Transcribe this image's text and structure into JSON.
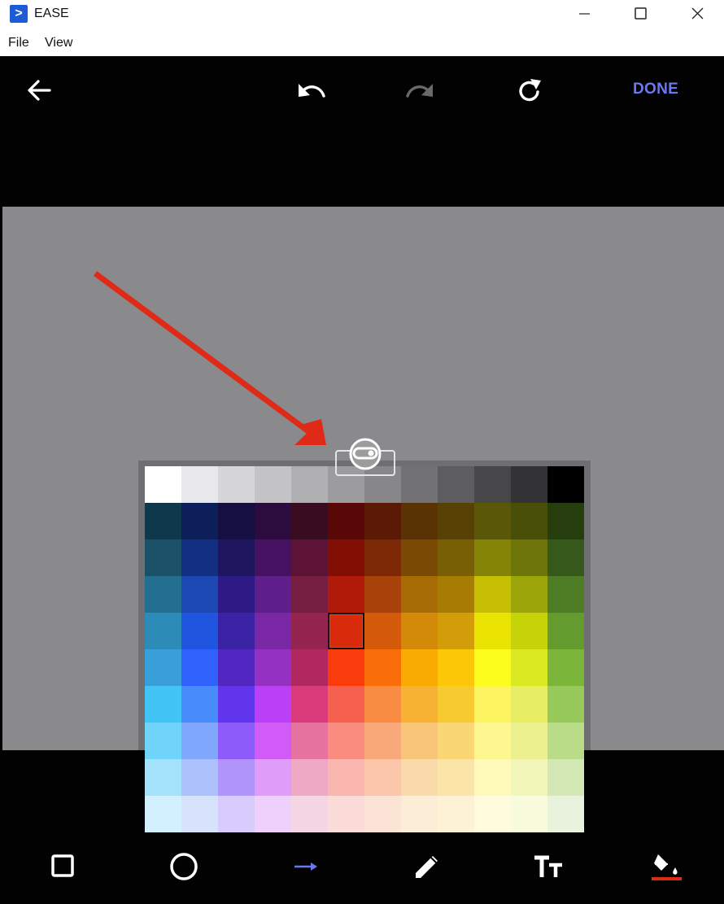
{
  "window": {
    "title": "EASE",
    "logo_glyph": ">",
    "controls": [
      "minimize-icon",
      "maximize-icon",
      "close-icon"
    ]
  },
  "menu": {
    "items": [
      "File",
      "View"
    ]
  },
  "toolbar": {
    "back_icon": "arrow-left-icon",
    "undo_icon": "undo-icon",
    "redo_icon": "redo-icon",
    "redo_enabled": false,
    "reset_icon": "refresh-icon",
    "done_label": "DONE",
    "done_color": "#6b78f0"
  },
  "canvas": {
    "background": "#8a898c",
    "annotation": {
      "type": "arrow",
      "color": "#e02a18"
    }
  },
  "palette": {
    "selected": {
      "row": 4,
      "col": 5
    },
    "rows": [
      [
        "#ffffff",
        "#e8e7ea",
        "#d6d5d7",
        "#c4c3c6",
        "#b0afb2",
        "#9c9b9e",
        "#878688",
        "#727174",
        "#5d5c5f",
        "#474648",
        "#333234",
        "#000000"
      ],
      [
        "#10384d",
        "#0d1f5a",
        "#150f42",
        "#2c0c3e",
        "#3a0c22",
        "#5a0707",
        "#5a1a06",
        "#5a3304",
        "#574104",
        "#5a5708",
        "#4a4f07",
        "#263d0e"
      ],
      [
        "#1a5168",
        "#122f82",
        "#1f1660",
        "#471161",
        "#5c1335",
        "#820f04",
        "#7e2906",
        "#7a4a05",
        "#785f05",
        "#858406",
        "#6f7609",
        "#36581a"
      ],
      [
        "#236f91",
        "#1c48b4",
        "#2d1a85",
        "#5e1f8a",
        "#761d42",
        "#b01a08",
        "#a8410a",
        "#a86c06",
        "#a67c05",
        "#c6bf03",
        "#9ca60b",
        "#4e7c24"
      ],
      [
        "#2d8bb7",
        "#2055e0",
        "#3a22a4",
        "#7a27a6",
        "#942450",
        "#d92a0b",
        "#d25a0a",
        "#d48a09",
        "#d29d08",
        "#eae302",
        "#c6d308",
        "#639b2f"
      ],
      [
        "#389fd8",
        "#2f62fa",
        "#5226c0",
        "#9431c2",
        "#b0285f",
        "#fa3c0d",
        "#f96d0a",
        "#f9aa03",
        "#fcc707",
        "#fcfd1c",
        "#dbe922",
        "#7bb53a"
      ],
      [
        "#42c4f7",
        "#488bfb",
        "#6035ec",
        "#b940f6",
        "#dc3b7b",
        "#f6604e",
        "#f78c42",
        "#f8b233",
        "#f8ca32",
        "#fdf462",
        "#e7ee64",
        "#97ca5b"
      ],
      [
        "#70d3fa",
        "#7fa7fb",
        "#8d5bfa",
        "#d05bf7",
        "#e672a0",
        "#f98b7f",
        "#f8a879",
        "#f8c579",
        "#f8d774",
        "#fef68f",
        "#ecf08f",
        "#b9dc89"
      ],
      [
        "#a4e2fb",
        "#adc2fc",
        "#b094fa",
        "#e09cf9",
        "#eea9c5",
        "#fab7b0",
        "#fac7ab",
        "#fad9aa",
        "#fbe4a8",
        "#fef9b8",
        "#f3f6b9",
        "#d3e8b4"
      ],
      [
        "#d2f0fd",
        "#d7e3fd",
        "#dacbfd",
        "#efcffc",
        "#f5d6e3",
        "#fbdcd8",
        "#fbe4d6",
        "#fcedd7",
        "#fdf2d6",
        "#fefcdd",
        "#f9fbdd",
        "#e8f2dc"
      ]
    ]
  },
  "bottom_tools": {
    "items": [
      "rectangle-icon",
      "circle-icon",
      "arrow-right-icon",
      "pencil-icon",
      "text-size-icon",
      "paint-bucket-icon"
    ],
    "active": "arrow-right-icon",
    "active_color": "#6b78f0",
    "fill_color": "#e02a18"
  }
}
